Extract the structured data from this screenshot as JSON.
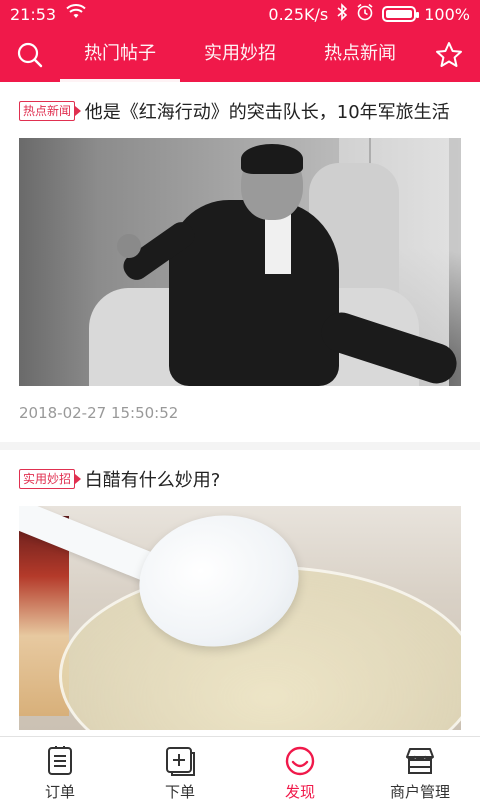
{
  "status_bar": {
    "time": "21:53",
    "network_speed": "0.25K/s",
    "battery": "100%"
  },
  "header": {
    "tabs": [
      {
        "label": "热门帖子",
        "active": true
      },
      {
        "label": "实用妙招",
        "active": false
      },
      {
        "label": "热点新闻",
        "active": false
      }
    ],
    "accent_color": "#f0194a"
  },
  "feed": {
    "posts": [
      {
        "tag": "热点新闻",
        "title": "他是《红海行动》的突击队长，10年军旅生活",
        "date": "2018-02-27 15:50:52"
      },
      {
        "tag": "实用妙招",
        "title": "白醋有什么妙用?"
      }
    ]
  },
  "bottom_nav": {
    "items": [
      {
        "label": "订单",
        "icon": "order-list-icon",
        "active": false
      },
      {
        "label": "下单",
        "icon": "add-order-icon",
        "active": false
      },
      {
        "label": "发现",
        "icon": "discover-icon",
        "active": true
      },
      {
        "label": "商户管理",
        "icon": "store-icon",
        "active": false
      }
    ]
  }
}
